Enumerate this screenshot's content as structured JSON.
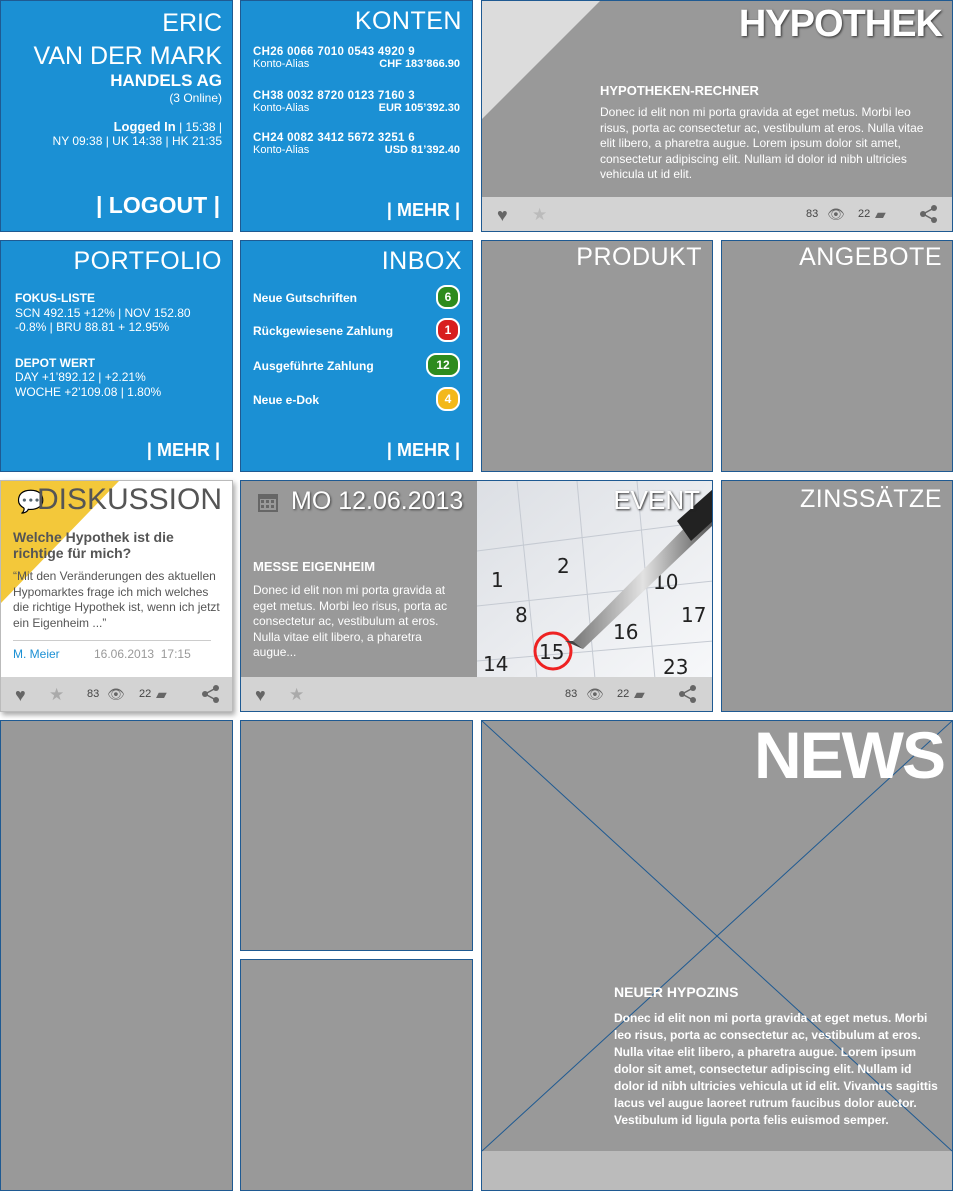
{
  "user": {
    "first_name": "ERIC",
    "last_name": "VAN DER MARK",
    "company": "HANDELS AG",
    "online": "(3 Online)",
    "logged_in_label": "Logged In",
    "logged_in_time": "| 15:38 |",
    "world_clock": "NY 09:38 | UK 14:38 | HK 21:35",
    "logout_label": "| LOGOUT |"
  },
  "konten": {
    "title": "KONTEN",
    "accounts": [
      {
        "number": "CH26 0066 7010 0543 4920 9",
        "alias": "Konto-Alias",
        "balance": "CHF 183’866.90"
      },
      {
        "number": "CH38 0032 8720 0123 7160 3",
        "alias": "Konto-Alias",
        "balance": "EUR 105’392.30"
      },
      {
        "number": "CH24 0082 3412 5672 3251 6",
        "alias": "Konto-Alias",
        "balance": "USD 81’392.40"
      }
    ],
    "more_label": "| MEHR |"
  },
  "hypothek": {
    "title": "HYPOTHEK",
    "subtitle": "HYPOTHEKEN-RECHNER",
    "text": "Donec id elit non mi porta gravida at eget metus. Morbi leo risus, porta ac consectetur ac, vestibulum at eros. Nulla vitae elit libero, a pharetra augue. Lorem ipsum dolor sit amet, consectetur adipiscing elit. Nullam id dolor id nibh ultricies vehicula ut id elit.",
    "views": "83",
    "comments": "22"
  },
  "portfolio": {
    "title": "PORTFOLIO",
    "focus_label": "FOKUS-LISTE",
    "focus_line1": "SCN 492.15 +12% | NOV 152.80",
    "focus_line2": "-0.8% | BRU 88.81 + 12.95%",
    "depot_label": "DEPOT WERT",
    "depot_line1": "DAY +1’892.12 | +2.21%",
    "depot_line2": "WOCHE +2’109.08 | 1.80%",
    "more_label": "| MEHR |"
  },
  "inbox": {
    "title": "INBOX",
    "items": [
      {
        "label": "Neue Gutschriften",
        "count": "6",
        "color": "#2e8b1e"
      },
      {
        "label": "Rückgewiesene Zahlung",
        "count": "1",
        "color": "#d81e1e"
      },
      {
        "label": "Ausgeführte Zahlung",
        "count": "12",
        "color": "#2e8b1e"
      },
      {
        "label": "Neue e-Dok",
        "count": "4",
        "color": "#f3b81b"
      }
    ],
    "more_label": "| MEHR |"
  },
  "produkt": {
    "title": "PRODUKT"
  },
  "angebote": {
    "title": "ANGEBOTE"
  },
  "diskussion": {
    "title": "DISKUSSION",
    "question": "Welche Hypothek ist die richtige für mich?",
    "quote": "“Mit den Veränderungen des aktuellen Hypomarktes frage ich mich welches die richtige Hypothek ist, wenn ich jetzt ein Eigenheim ...”",
    "author": "M. Meier",
    "date": "16.06.2013",
    "time": "17:15",
    "views": "83",
    "comments": "22"
  },
  "event": {
    "date": "MO 12.06.2013",
    "label": "EVENT",
    "subtitle": "MESSE EIGENHEIM",
    "text": "Donec id elit non mi porta gravida at eget metus. Morbi leo risus, porta ac consectetur ac, vestibulum at eros. Nulla vitae elit libero, a pharetra augue...",
    "views": "83",
    "comments": "22",
    "calendar_numbers": [
      "2",
      "1",
      "8",
      "10",
      "17",
      "16",
      "15",
      "14",
      "23"
    ]
  },
  "zinssaetze": {
    "title": "ZINSSÄTZE"
  },
  "news": {
    "title": "NEWS",
    "subtitle": "NEUER HYPOZINS",
    "text": "Donec id elit non mi porta gravida at eget metus. Morbi leo risus, porta ac consectetur ac, vestibulum at eros. Nulla vitae elit libero, a pharetra augue. Lorem ipsum dolor sit amet, consectetur adipiscing elit. Nullam id dolor id nibh ultricies vehicula ut id elit. Vivamus sagittis lacus vel augue laoreet rutrum faucibus dolor auctor. Vestibulum id ligula porta felis euismod semper."
  },
  "colors": {
    "tile_blue": "#1b90d4",
    "tile_gray": "#999999",
    "accent_yellow": "#f3c83a"
  },
  "icons": [
    "heart-icon",
    "star-icon",
    "eye-icon",
    "comment-icon",
    "share-icon",
    "speech-bubble-icon",
    "calendar-icon"
  ]
}
